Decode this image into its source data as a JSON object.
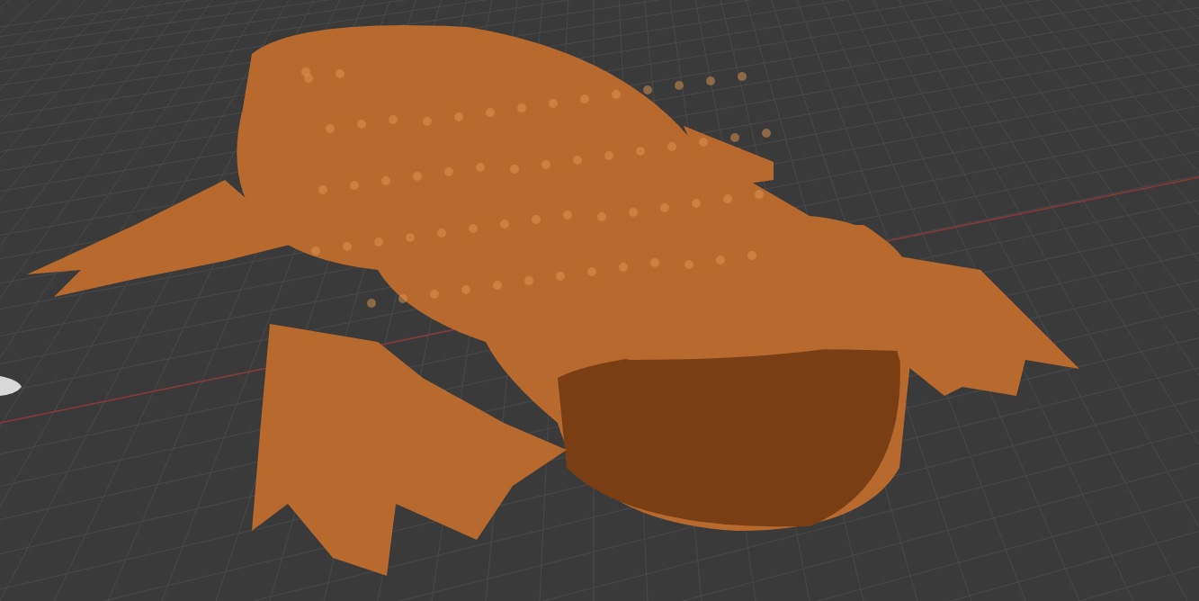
{
  "viewport": {
    "grid": true,
    "x_axis": true,
    "model": true
  }
}
